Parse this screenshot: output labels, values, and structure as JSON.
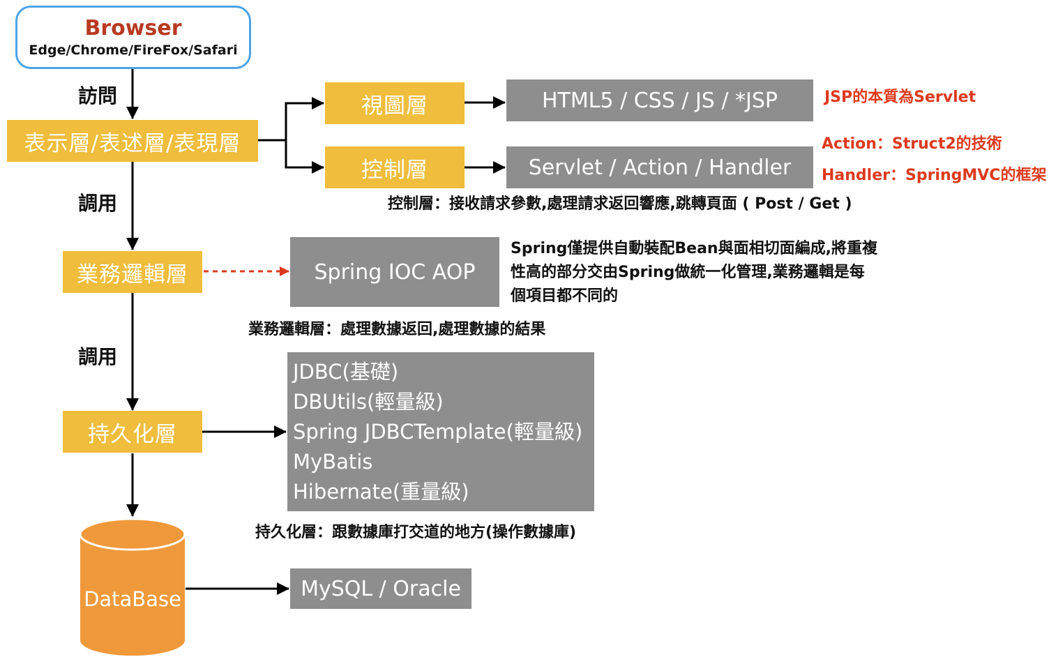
{
  "browser": {
    "title": "Browser",
    "subtitle": "Edge/Chrome/FireFox/Safari"
  },
  "edges": {
    "visit": "訪問",
    "call1": "調用",
    "call2": "調用"
  },
  "layers": {
    "presentation": "表示層/表述層/表現層",
    "view": "視圖層",
    "control": "控制層",
    "business": "業務邏輯層",
    "persistence": "持久化層",
    "database": "DataBase"
  },
  "tech": {
    "view": "HTML5 / CSS / JS / *JSP",
    "control": "Servlet / Action / Handler",
    "spring": "Spring IOC AOP",
    "persistence_items": [
      "JDBC(基礎)",
      "DBUtils(輕量級)",
      "Spring JDBCTemplate(輕量級)",
      "MyBatis",
      "Hibernate(重量級)"
    ],
    "db": "MySQL / Oracle"
  },
  "notes": {
    "jsp": "JSP的本質為Servlet",
    "action": "Action：Struct2的技術",
    "handler": "Handler：SpringMVC的框架",
    "control_desc": "控制層：接收請求參數,處理請求返回響應,跳轉頁面 ( Post / Get )",
    "spring_desc_lines": [
      "Spring僅提供自動裝配Bean與面相切面編成,將重複",
      "性高的部分交由Spring做統一化管理,業務邏輯是每",
      "個項目都不同的"
    ],
    "business_desc": "業務邏輯層：處理數據返回,處理數據的結果",
    "persistence_desc": "持久化層：跟數據庫打交道的地方(操作數據庫)"
  },
  "colors": {
    "layer": "#f0bd3c",
    "tech": "#8e8e8e",
    "note_red": "#dc3a1e",
    "db": "#f0993a",
    "browser_border": "#4da3e6"
  }
}
